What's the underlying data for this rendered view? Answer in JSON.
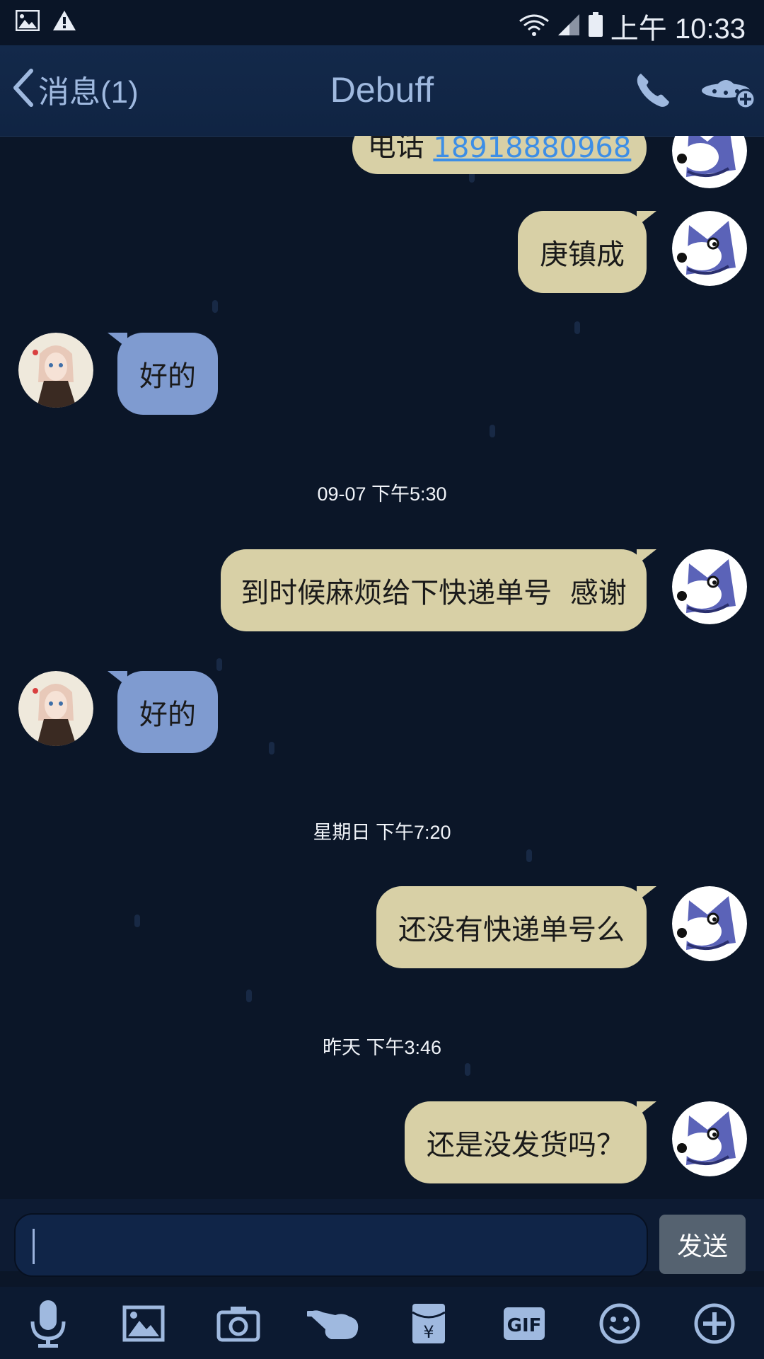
{
  "status": {
    "time": "上午 10:33",
    "icons": [
      "image-icon",
      "warning-icon",
      "wifi-icon",
      "signal-icon",
      "battery-icon"
    ]
  },
  "nav": {
    "back_label": "消息(1)",
    "title": "Debuff",
    "icons": [
      "chevron-left-icon",
      "phone-icon",
      "ufo-add-icon"
    ]
  },
  "chat": {
    "partial_message": {
      "text": "电话",
      "link": "18918880968"
    },
    "messages": [
      {
        "sender": "me",
        "text": "庚镇成"
      },
      {
        "sender": "them",
        "text": "好的"
      },
      {
        "timestamp": "09-07 下午5:30"
      },
      {
        "sender": "me",
        "text": "到时候麻烦给下快递单号  感谢"
      },
      {
        "sender": "them",
        "text": "好的"
      },
      {
        "timestamp": "星期日 下午7:20"
      },
      {
        "sender": "me",
        "text": "还没有快递单号么"
      },
      {
        "timestamp": "昨天 下午3:46"
      },
      {
        "sender": "me",
        "text": "还是没发货吗？"
      }
    ]
  },
  "composer": {
    "input_value": "",
    "send_label": "发送"
  },
  "toolbar": {
    "icons": [
      "microphone-icon",
      "picture-icon",
      "camera-icon",
      "poke-hand-icon",
      "red-packet-icon",
      "gif-icon",
      "emoji-icon",
      "plus-icon"
    ],
    "gif_label": "GIF",
    "yen_label": "¥"
  },
  "colors": {
    "background": "#0b1628",
    "my_bubble": "#d8d0a6",
    "their_bubble": "#7f9bd0",
    "nav_text": "#9fb9df",
    "link": "#3d8ee6"
  }
}
